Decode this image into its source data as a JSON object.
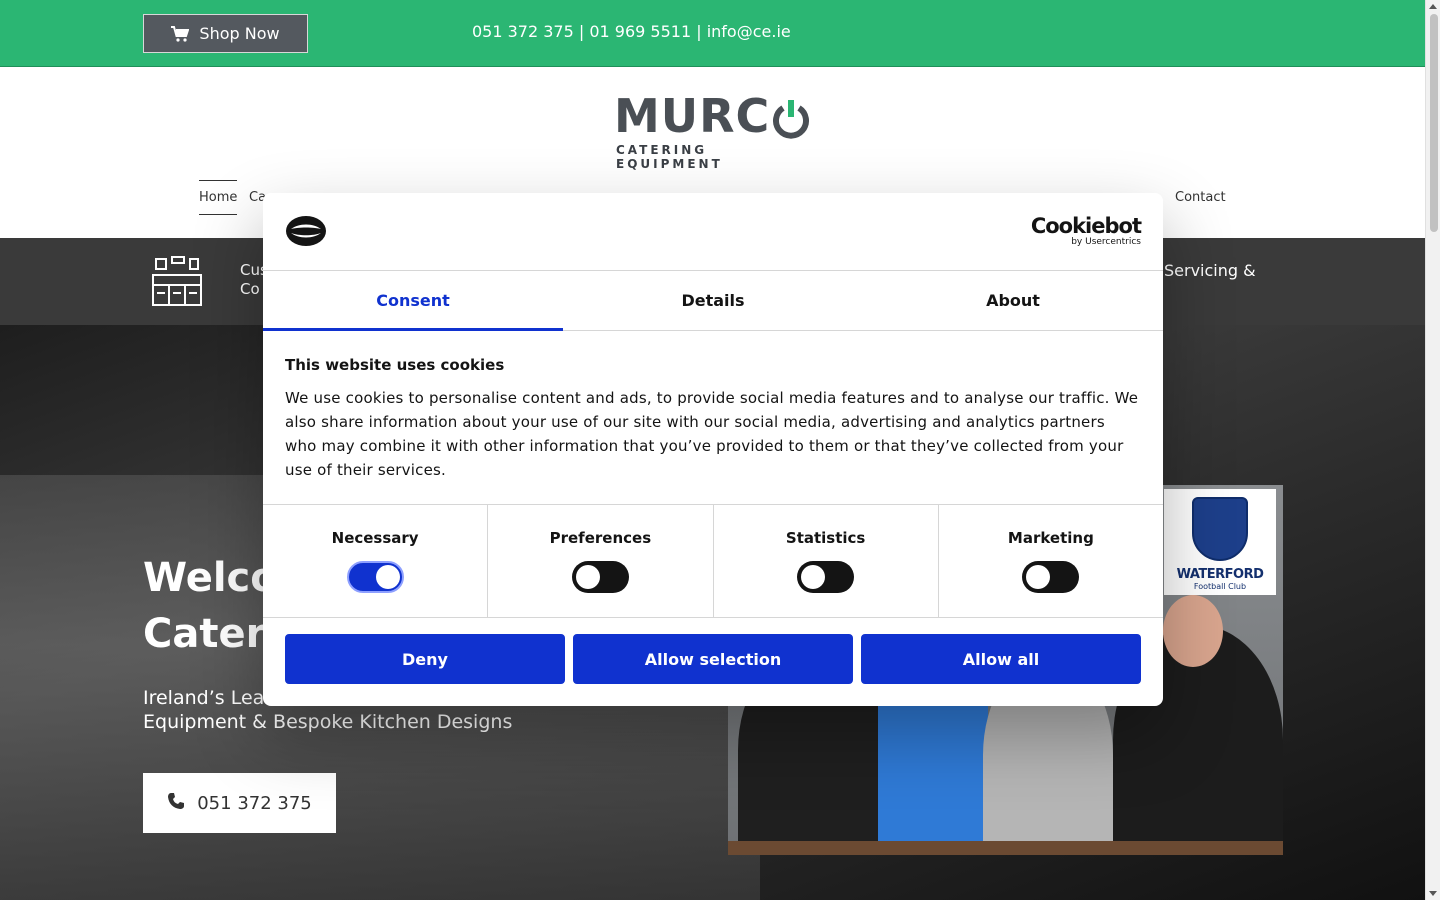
{
  "topbar": {
    "shop_label": "Shop Now",
    "contact": "051 372 375 | 01 969 5511 | info@ce.ie"
  },
  "logo": {
    "word": "MURC",
    "sub": "CATERING EQUIPMENT"
  },
  "nav": {
    "home": "Home",
    "partial": "Ca",
    "contact": "Contact"
  },
  "services": {
    "left_line1": "Cus",
    "left_line2": "Co",
    "right": "Servicing &"
  },
  "hero": {
    "title_line1": "Welco",
    "title_line2": "Cater",
    "sub_line1": "Ireland’s Lea",
    "sub_line2": "Equipment & Bespoke Kitchen Designs",
    "phone": "051 372 375"
  },
  "photo": {
    "crest_name": "WATERFORD",
    "crest_club": "Football Club"
  },
  "cookie": {
    "brand": "Cookiebot",
    "brand_by": "by Usercentrics",
    "tabs": [
      "Consent",
      "Details",
      "About"
    ],
    "title": "This website uses cookies",
    "text": "We use cookies to personalise content and ads, to provide social media features and to analyse our traffic. We also share information about your use of our site with our social media, advertising and analytics partners who may combine it with other information that you’ve provided to them or that they’ve collected from your use of their services.",
    "toggles": [
      {
        "label": "Necessary",
        "on": true
      },
      {
        "label": "Preferences",
        "on": false
      },
      {
        "label": "Statistics",
        "on": false
      },
      {
        "label": "Marketing",
        "on": false
      }
    ],
    "buttons": {
      "deny": "Deny",
      "allow_selection": "Allow selection",
      "allow_all": "Allow all"
    }
  },
  "colors": {
    "green": "#2bb673",
    "cookie_blue": "#1032cf",
    "dark_strip": "#3a3a3a"
  }
}
